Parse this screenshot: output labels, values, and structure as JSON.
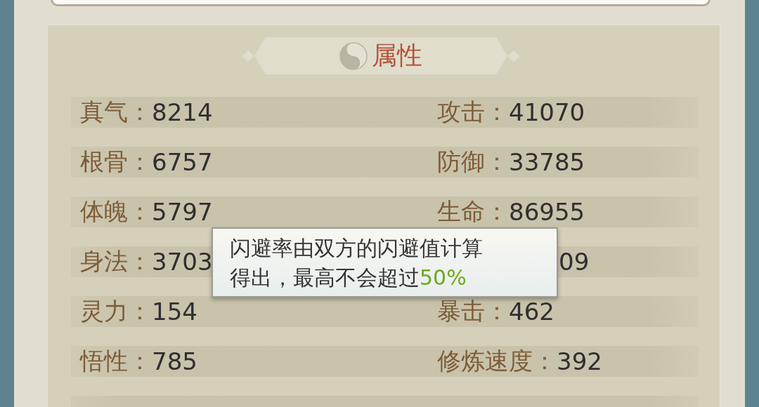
{
  "panel": {
    "title": "属性"
  },
  "rows": [
    {
      "left": {
        "label": "真气：",
        "value": "8214"
      },
      "right": {
        "label": "攻击：",
        "value": "41070"
      }
    },
    {
      "left": {
        "label": "根骨：",
        "value": "6757"
      },
      "right": {
        "label": "防御：",
        "value": "33785"
      }
    },
    {
      "left": {
        "label": "体魄：",
        "value": "5797"
      },
      "right": {
        "label": "生命：",
        "value": "86955"
      }
    },
    {
      "left": {
        "label": "身法：",
        "value": "3703"
      },
      "right": {
        "value": "09"
      }
    },
    {
      "left": {
        "label": "灵力：",
        "value": "154"
      },
      "right": {
        "label": "暴击：",
        "value": "462"
      }
    },
    {
      "left": {
        "label": "悟性：",
        "value": "785"
      },
      "right": {
        "label": "修炼速度：",
        "value": "392"
      }
    }
  ],
  "tooltip": {
    "text": "闪避率由双方的闪避值计算得出，最高不会超过",
    "highlight": "50%"
  }
}
